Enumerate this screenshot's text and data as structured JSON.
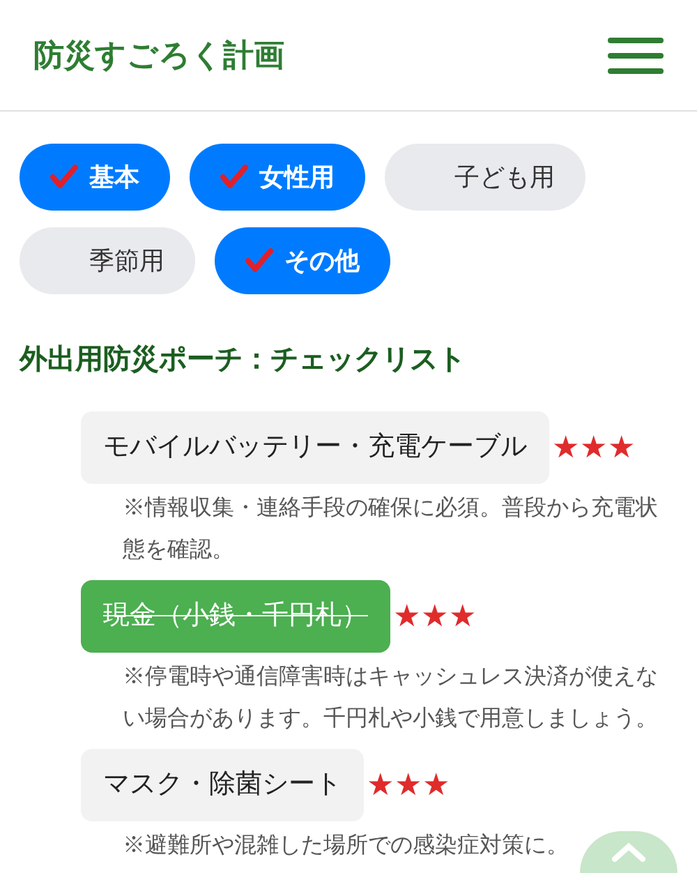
{
  "header": {
    "title": "防災すごろく計画"
  },
  "filters": [
    {
      "label": "基本",
      "checked": true
    },
    {
      "label": "女性用",
      "checked": true
    },
    {
      "label": "子ども用",
      "checked": false
    },
    {
      "label": "季節用",
      "checked": false
    },
    {
      "label": "その他",
      "checked": true
    }
  ],
  "section": {
    "title": "外出用防災ポーチ：チェックリスト"
  },
  "items": [
    {
      "label": "モバイルバッテリー・充電ケーブル",
      "done": false,
      "stars": 3,
      "note": "※情報収集・連絡手段の確保に必須。普段から充電状態を確認。"
    },
    {
      "label": "現金（小銭・千円札）",
      "done": true,
      "stars": 3,
      "note": "※停電時や通信障害時はキャッシュレス決済が使えない場合があります。千円札や小銭で用意しましょう。"
    },
    {
      "label": "マスク・除菌シート",
      "done": false,
      "stars": 3,
      "note": "※避難所や混雑した場所での感染症対策に。"
    }
  ]
}
